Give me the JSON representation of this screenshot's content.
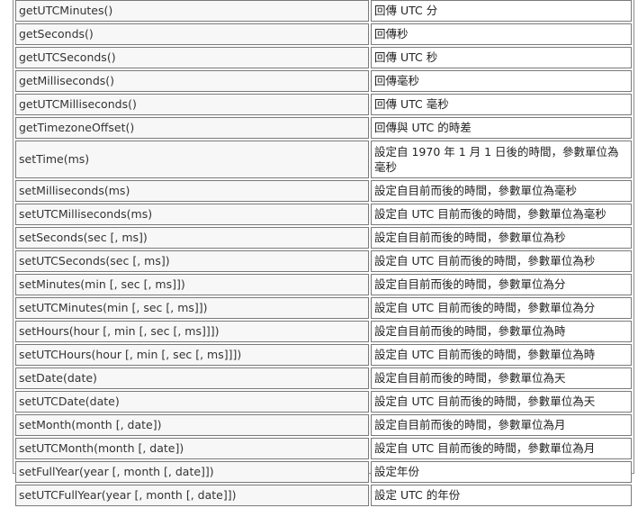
{
  "rows": [
    {
      "method": "getUTCMinutes()",
      "desc": "回傳 UTC 分"
    },
    {
      "method": "getSeconds()",
      "desc": "回傳秒"
    },
    {
      "method": "getUTCSeconds()",
      "desc": "回傳 UTC 秒"
    },
    {
      "method": "getMilliseconds()",
      "desc": "回傳毫秒"
    },
    {
      "method": "getUTCMilliseconds()",
      "desc": "回傳 UTC 毫秒"
    },
    {
      "method": "getTimezoneOffset()",
      "desc": "回傳與 UTC 的時差"
    },
    {
      "method": "setTime(ms)",
      "desc": "設定自 1970 年 1 月 1 日後的時間，參數單位為毫秒"
    },
    {
      "method": "setMilliseconds(ms)",
      "desc": "設定自目前而後的時間，參數單位為毫秒"
    },
    {
      "method": "setUTCMilliseconds(ms)",
      "desc": "設定自 UTC 目前而後的時間，參數單位為毫秒"
    },
    {
      "method": "setSeconds(sec [, ms])",
      "desc": "設定自目前而後的時間，參數單位為秒"
    },
    {
      "method": "setUTCSeconds(sec [, ms])",
      "desc": "設定自 UTC 目前而後的時間，參數單位為秒"
    },
    {
      "method": "setMinutes(min [, sec [, ms]])",
      "desc": "設定自目前而後的時間，參數單位為分"
    },
    {
      "method": "setUTCMinutes(min [, sec [, ms]])",
      "desc": "設定自 UTC 目前而後的時間，參數單位為分"
    },
    {
      "method": "setHours(hour [, min [, sec [, ms]]])",
      "desc": "設定自目前而後的時間，參數單位為時"
    },
    {
      "method": "setUTCHours(hour [, min [, sec [, ms]]])",
      "desc": "設定自 UTC 目前而後的時間，參數單位為時"
    },
    {
      "method": "setDate(date)",
      "desc": "設定自目前而後的時間，參數單位為天"
    },
    {
      "method": "setUTCDate(date)",
      "desc": "設定自 UTC 目前而後的時間，參數單位為天"
    },
    {
      "method": "setMonth(month [, date])",
      "desc": "設定自目前而後的時間，參數單位為月"
    },
    {
      "method": "setUTCMonth(month [, date])",
      "desc": "設定自 UTC 目前而後的時間，參數單位為月"
    },
    {
      "method": "setFullYear(year [, month [, date]])",
      "desc": "設定年份"
    },
    {
      "method": "setUTCFullYear(year [, month [, date]])",
      "desc": "設定 UTC 的年份"
    }
  ]
}
